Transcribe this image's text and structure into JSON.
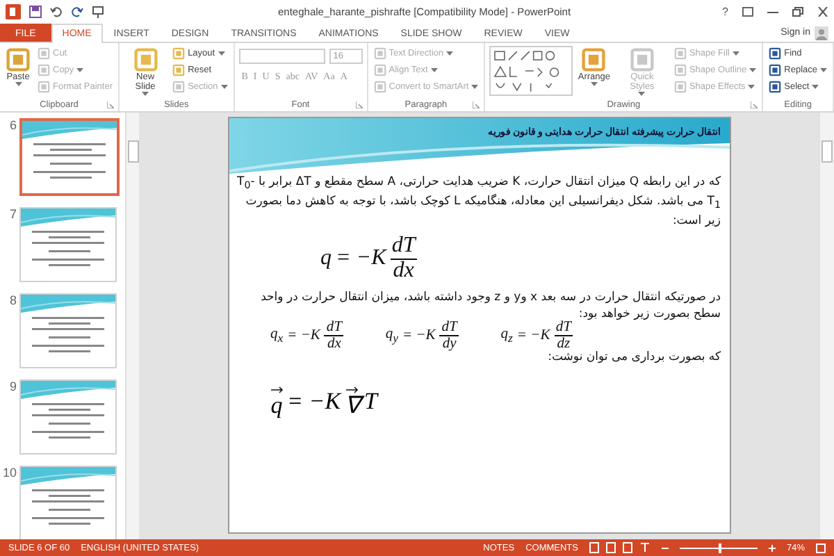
{
  "window": {
    "title": "enteghale_harante_pishrafte [Compatibility Mode] - PowerPoint",
    "help": "?",
    "sign_in": "Sign in"
  },
  "tabs": [
    {
      "label": "FILE",
      "kind": "file",
      "selected": false
    },
    {
      "label": "HOME",
      "kind": "tab",
      "selected": true
    },
    {
      "label": "INSERT",
      "kind": "tab",
      "selected": false
    },
    {
      "label": "DESIGN",
      "kind": "tab",
      "selected": false
    },
    {
      "label": "TRANSITIONS",
      "kind": "tab",
      "selected": false
    },
    {
      "label": "ANIMATIONS",
      "kind": "tab",
      "selected": false
    },
    {
      "label": "SLIDE SHOW",
      "kind": "tab",
      "selected": false
    },
    {
      "label": "REVIEW",
      "kind": "tab",
      "selected": false
    },
    {
      "label": "VIEW",
      "kind": "tab",
      "selected": false
    }
  ],
  "ribbon": [
    {
      "kind": "standard",
      "label": "Clipboard",
      "launcher": true,
      "big": [
        {
          "label": "Paste",
          "dropdown": true,
          "disabled": false
        }
      ],
      "small": [
        {
          "label": "Cut",
          "dropdown": false,
          "disabled": true
        },
        {
          "label": "Copy",
          "dropdown": true,
          "disabled": true
        },
        {
          "label": "Format Painter",
          "dropdown": false,
          "disabled": true
        }
      ]
    },
    {
      "kind": "standard",
      "label": "Slides",
      "launcher": false,
      "big": [
        {
          "label": "New Slide",
          "dropdown": true,
          "disabled": false
        }
      ],
      "small": [
        {
          "label": "Layout",
          "dropdown": true,
          "disabled": false
        },
        {
          "label": "Reset",
          "dropdown": false,
          "disabled": false
        },
        {
          "label": "Section",
          "dropdown": true,
          "disabled": true
        }
      ]
    },
    {
      "kind": "font",
      "label": "Font",
      "launcher": true,
      "font_size": "16",
      "buttons": [
        "B",
        "I",
        "U",
        "S",
        "abc",
        "AV",
        "Aa",
        "A"
      ]
    },
    {
      "kind": "standard",
      "label": "Paragraph",
      "launcher": true,
      "small": [
        {
          "label": "Text Direction",
          "dropdown": true,
          "disabled": true
        },
        {
          "label": "Align Text",
          "dropdown": true,
          "disabled": true
        },
        {
          "label": "Convert to SmartArt",
          "dropdown": true,
          "disabled": true
        }
      ]
    },
    {
      "kind": "drawing",
      "label": "Drawing",
      "launcher": true,
      "big": [
        {
          "label": "Arrange",
          "dropdown": true,
          "disabled": false
        },
        {
          "label": "Quick Styles",
          "dropdown": true,
          "disabled": true
        }
      ],
      "small": [
        {
          "label": "Shape Fill",
          "dropdown": true,
          "disabled": true
        },
        {
          "label": "Shape Outline",
          "dropdown": true,
          "disabled": true
        },
        {
          "label": "Shape Effects",
          "dropdown": true,
          "disabled": true
        }
      ]
    },
    {
      "kind": "standard",
      "label": "Editing",
      "launcher": false,
      "small": [
        {
          "label": "Find",
          "dropdown": false,
          "disabled": false
        },
        {
          "label": "Replace",
          "dropdown": true,
          "disabled": false
        },
        {
          "label": "Select",
          "dropdown": true,
          "disabled": false
        }
      ]
    }
  ],
  "thumbnails": [
    {
      "number": "6",
      "selected": true
    },
    {
      "number": "7",
      "selected": false
    },
    {
      "number": "8",
      "selected": false
    },
    {
      "number": "9",
      "selected": false
    },
    {
      "number": "10",
      "selected": false
    }
  ],
  "slide": {
    "title": "انتقال حرارت پیشرفته انتقال حرارت هدایتی و قانون فوریه",
    "body": [
      {
        "kind": "paragraph",
        "text": "که در این رابطه Q میزان انتقال حرارت، K ضریب هدایت حرارتی، A سطح مقطع و ΔT برابر با T$_{0}$-T$_{1}$ می باشد. شکل دیفرانسیلی این معادله، هنگامیکه  L کوچک باشد، با توجه به کاهش دما بصورت زیر است:"
      },
      {
        "kind": "equations",
        "items": [
          {
            "lhs": "q",
            "rhs": "= −K",
            "num": "dT",
            "den": "dx"
          }
        ]
      },
      {
        "kind": "paragraph",
        "text": "در صورتیکه انتقال حرارت در سه بعد x وy و z وجود داشته باشد، میزان انتقال حرارت در واحد سطح بصورت زیر خواهد بود:"
      },
      {
        "kind": "equations",
        "items": [
          {
            "lhs": "q",
            "sub": "x",
            "rhs": "= −K",
            "num": "dT",
            "den": "dx"
          },
          {
            "lhs": "q",
            "sub": "y",
            "rhs": "= −K",
            "num": "dT",
            "den": "dy"
          },
          {
            "lhs": "q",
            "sub": "z",
            "rhs": "= −K",
            "num": "dT",
            "den": "dz"
          }
        ]
      },
      {
        "kind": "paragraph",
        "text": "که بصورت برداری می توان نوشت:"
      },
      {
        "kind": "vector",
        "lhs": "q",
        "rhs": "= −K",
        "op": "∇",
        "var": "T"
      }
    ]
  },
  "status_bar": {
    "slide_info": "SLIDE 6 OF 60",
    "language": "ENGLISH (UNITED STATES)",
    "notes": "NOTES",
    "comments": "COMMENTS",
    "zoom": {
      "level": 0.5,
      "reading": "74%"
    }
  }
}
